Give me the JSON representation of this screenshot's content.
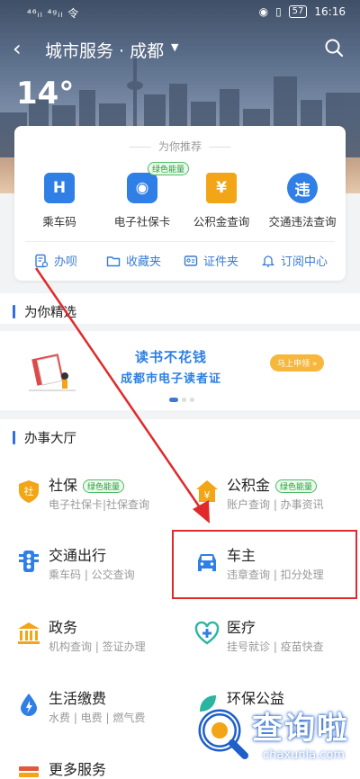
{
  "status_bar": {
    "left": "⁴⁶ᵢₗ ⁴ᵍᵢₗ 令",
    "battery": "57",
    "time": "16:16"
  },
  "header": {
    "title": "城市服务 · 成都",
    "temperature": "14°"
  },
  "recommend": {
    "title": "为你推荐",
    "items": [
      {
        "label": "乘车码",
        "icon": "bus-code-icon",
        "glyph": "H",
        "color": "#2f7fe6"
      },
      {
        "label": "电子社保卡",
        "icon": "social-card-icon",
        "glyph": "◉",
        "color": "#2f7fe6",
        "tag": "绿色能量"
      },
      {
        "label": "公积金查询",
        "icon": "housing-fund-icon",
        "glyph": "¥",
        "color": "#f2a516"
      },
      {
        "label": "交通违法查询",
        "icon": "traffic-violation-icon",
        "glyph": "违",
        "color": "#2f7fe6"
      }
    ],
    "quick_links": [
      "办呗",
      "收藏夹",
      "证件夹",
      "订阅中心"
    ]
  },
  "picks": {
    "heading": "为你精选",
    "banner_title": "读书不花钱",
    "banner_subtitle": "成都市电子读者证",
    "banner_button": "马上申领 »"
  },
  "hall": {
    "heading": "办事大厅",
    "services": [
      {
        "name": "社保",
        "desc": "电子社保卡|社保查询",
        "tag": "绿色能量"
      },
      {
        "name": "公积金",
        "desc": "账户查询 | 办事资讯",
        "tag": "绿色能量"
      },
      {
        "name": "交通出行",
        "desc": "乘车码 | 公交查询"
      },
      {
        "name": "车主",
        "desc": "违章查询 | 扣分处理"
      },
      {
        "name": "政务",
        "desc": "机构查询 | 签证办理"
      },
      {
        "name": "医疗",
        "desc": "挂号就诊 | 疫苗快查"
      },
      {
        "name": "生活缴费",
        "desc": "水费 | 电费 | 燃气费"
      },
      {
        "name": "环保公益",
        "desc": ""
      },
      {
        "name": "更多服务",
        "desc": ""
      }
    ]
  },
  "watermark": {
    "text": "查询啦",
    "url": "chaxunla.com"
  },
  "colors": {
    "accent": "#2f7fe6",
    "highlight": "#e02a2a"
  }
}
